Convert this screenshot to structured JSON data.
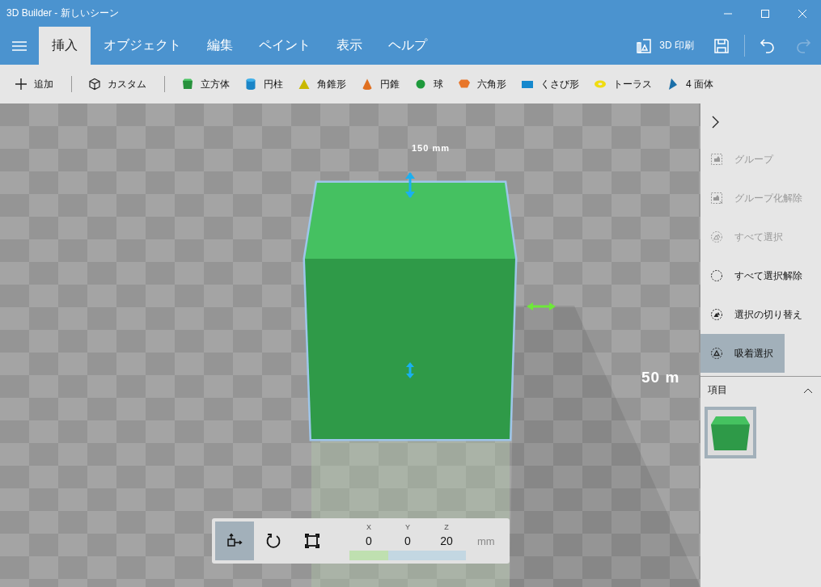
{
  "window": {
    "title": "3D Builder - 新しいシーン"
  },
  "menu": {
    "tabs": [
      {
        "label": "挿入",
        "selected": true
      },
      {
        "label": "オブジェクト",
        "selected": false
      },
      {
        "label": "編集",
        "selected": false
      },
      {
        "label": "ペイント",
        "selected": false
      },
      {
        "label": "表示",
        "selected": false
      },
      {
        "label": "ヘルプ",
        "selected": false
      }
    ],
    "actions": [
      {
        "kind": "print",
        "label": "3D 印刷",
        "disabled": false
      },
      {
        "kind": "save",
        "disabled": false
      },
      {
        "kind": "undo",
        "disabled": false
      },
      {
        "kind": "redo",
        "disabled": true
      }
    ]
  },
  "toolbar": [
    {
      "kind": "add",
      "label": "追加"
    },
    {
      "kind": "custom",
      "label": "カスタム"
    },
    {
      "kind": "cube",
      "label": "立方体"
    },
    {
      "kind": "cylinder",
      "label": "円柱"
    },
    {
      "kind": "pyramid",
      "label": "角錐形"
    },
    {
      "kind": "cone",
      "label": "円錐"
    },
    {
      "kind": "sphere",
      "label": "球"
    },
    {
      "kind": "hexagon",
      "label": "六角形"
    },
    {
      "kind": "wedge",
      "label": "くさび形"
    },
    {
      "kind": "torus",
      "label": "トーラス"
    },
    {
      "kind": "tetrahedron",
      "label": "4 面体"
    }
  ],
  "viewport": {
    "labels": [
      "150 mm",
      "50 m"
    ]
  },
  "transform_panel": {
    "tools": [
      {
        "kind": "move",
        "selected": true
      },
      {
        "kind": "rotate",
        "selected": false
      },
      {
        "kind": "scale",
        "selected": false
      }
    ],
    "axes": [
      {
        "label": "X",
        "value": "0"
      },
      {
        "label": "Y",
        "value": "0"
      },
      {
        "label": "Z",
        "value": "20"
      }
    ],
    "unit": "mm"
  },
  "sidebar": {
    "items": [
      {
        "kind": "group",
        "label": "グループ",
        "disabled": true,
        "selected": false
      },
      {
        "kind": "ungroup",
        "label": "グループ化解除",
        "disabled": true,
        "selected": false
      },
      {
        "kind": "select-all",
        "label": "すべて選択",
        "disabled": true,
        "selected": false
      },
      {
        "kind": "deselect-all",
        "label": "すべて選択解除",
        "disabled": false,
        "selected": false
      },
      {
        "kind": "toggle",
        "label": "選択の切り替え",
        "disabled": false,
        "selected": false
      },
      {
        "kind": "snap",
        "label": "吸着選択",
        "disabled": false,
        "selected": true
      }
    ],
    "section": {
      "title": "項目",
      "expanded": true
    },
    "objects": [
      {
        "selected": true
      }
    ]
  }
}
